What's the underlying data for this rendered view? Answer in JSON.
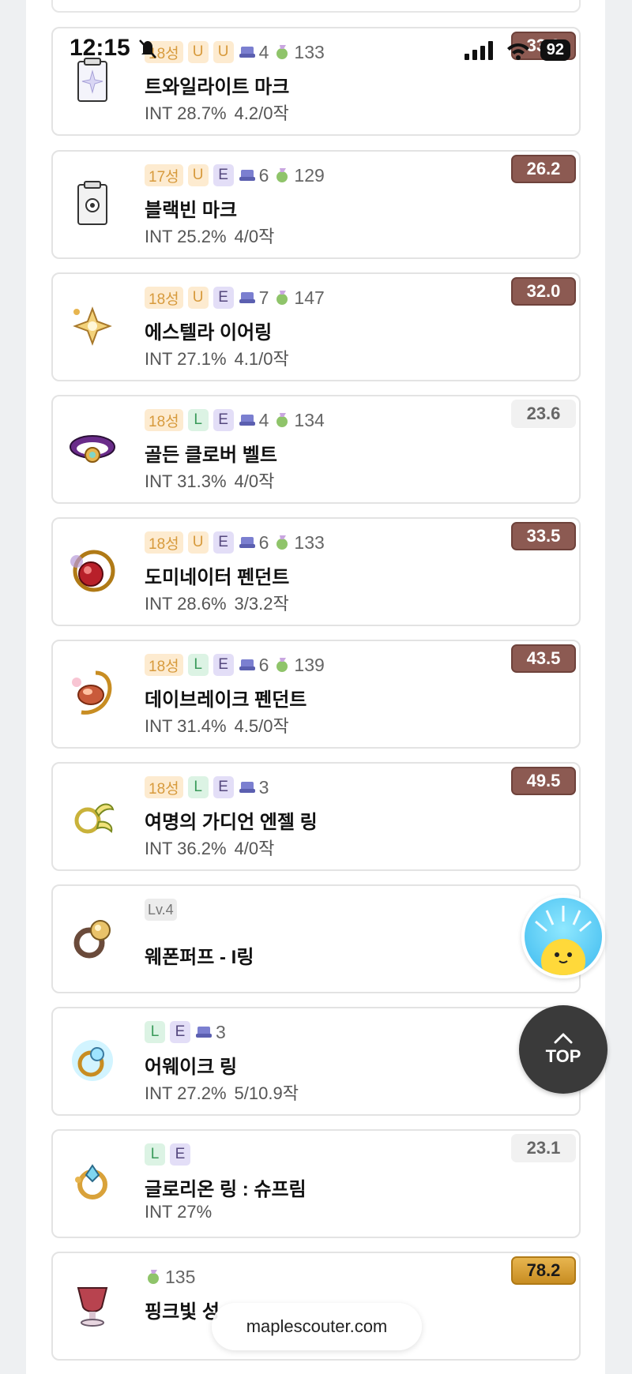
{
  "status_bar": {
    "time": "12:15",
    "battery": "92"
  },
  "items": [
    {
      "icon": "twilight-mark",
      "stars": "18성",
      "potential": "U",
      "additional": "U",
      "scrolls": "4",
      "level": "133",
      "name": "트와일라이트 마크",
      "stat": "INT 28.7%",
      "scroll_info": "4.2/0작",
      "score": "33.9",
      "score_style": "brown"
    },
    {
      "icon": "black-bean-mark",
      "stars": "17성",
      "potential": "U",
      "additional": "E",
      "scrolls": "6",
      "level": "129",
      "name": "블랙빈 마크",
      "stat": "INT 25.2%",
      "scroll_info": "4/0작",
      "score": "26.2",
      "score_style": "brown"
    },
    {
      "icon": "estella-earring",
      "stars": "18성",
      "potential": "U",
      "additional": "E",
      "scrolls": "7",
      "level": "147",
      "name": "에스텔라 이어링",
      "stat": "INT 27.1%",
      "scroll_info": "4.1/0작",
      "score": "32.0",
      "score_style": "brown"
    },
    {
      "icon": "golden-clover-belt",
      "stars": "18성",
      "potential": "L",
      "additional": "E",
      "scrolls": "4",
      "level": "134",
      "name": "골든 클로버 벨트",
      "stat": "INT 31.3%",
      "scroll_info": "4/0작",
      "score": "23.6",
      "score_style": "grey"
    },
    {
      "icon": "dominator-pendant",
      "stars": "18성",
      "potential": "U",
      "additional": "E",
      "scrolls": "6",
      "level": "133",
      "name": "도미네이터 펜던트",
      "stat": "INT 28.6%",
      "scroll_info": "3/3.2작",
      "score": "33.5",
      "score_style": "brown"
    },
    {
      "icon": "daybreak-pendant",
      "stars": "18성",
      "potential": "L",
      "additional": "E",
      "scrolls": "6",
      "level": "139",
      "name": "데이브레이크 펜던트",
      "stat": "INT 31.4%",
      "scroll_info": "4.5/0작",
      "score": "43.5",
      "score_style": "brown"
    },
    {
      "icon": "guardian-angel-ring",
      "stars": "18성",
      "potential": "L",
      "additional": "E",
      "scrolls": "3",
      "level": "",
      "name": "여명의 가디언 엔젤 링",
      "stat": "INT 36.2%",
      "scroll_info": "4/0작",
      "score": "49.5",
      "score_style": "brown"
    },
    {
      "icon": "weapon-puff-ring",
      "lv": "Lv.4",
      "name": "웨폰퍼프 - I링",
      "stat": "",
      "scroll_info": "",
      "score": "",
      "score_style": "none"
    },
    {
      "icon": "awake-ring",
      "potential": "L",
      "additional": "E",
      "scrolls": "3",
      "name": "어웨이크 링",
      "stat": "INT 27.2%",
      "scroll_info": "5/10.9작",
      "score": "",
      "score_style": "grey"
    },
    {
      "icon": "glorion-ring",
      "potential": "L",
      "additional": "E",
      "name": "글로리온 링 : 슈프림",
      "stat": "INT 27%",
      "scroll_info": "",
      "score": "23.1",
      "score_style": "grey"
    },
    {
      "icon": "pink-bean-cup",
      "level": "135",
      "name": "핑크빛 성",
      "stat": "",
      "scroll_info": "",
      "score": "78.2",
      "score_style": "gold"
    }
  ],
  "fab": {
    "top_label": "TOP"
  },
  "url_bar": {
    "url": "maplescouter.com"
  },
  "colors": {
    "score_brown": "#8c5a52",
    "score_gold": "#d9a23a",
    "badge_L": "#dcf3e4",
    "badge_U": "#fdebd0",
    "badge_E": "#e3def7"
  }
}
